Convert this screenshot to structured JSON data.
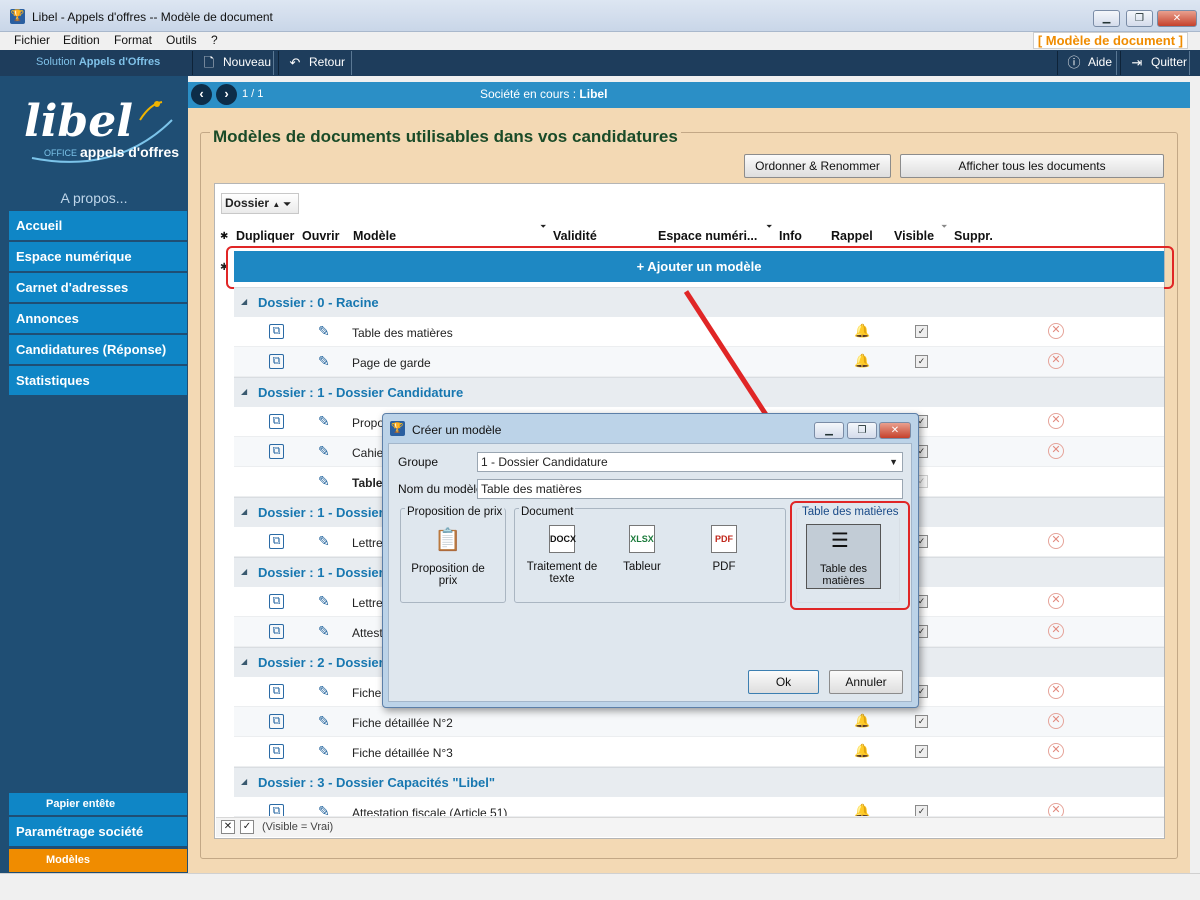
{
  "window": {
    "title": "Libel - Appels d'offres -- Modèle de document",
    "min": "▁",
    "max": "❐",
    "close": "✕"
  },
  "menu": [
    "Fichier",
    "Edition",
    "Format",
    "Outils",
    "?"
  ],
  "model_tag": "[ Modèle de document ]",
  "toolbar": {
    "solution_prefix": "Solution",
    "solution_name": "Appels d'Offres",
    "new_label": "Nouveau",
    "back_label": "Retour",
    "help_label": "Aide",
    "quit_label": "Quitter"
  },
  "sidebar": {
    "logo_text": "libel",
    "logo_sub_office": "OFFICE",
    "logo_sub": "appels d'offres",
    "about": "A propos...",
    "items": [
      "Accueil",
      "Espace numérique",
      "Carnet d'adresses",
      "Annonces",
      "Candidatures  (Réponse)",
      "Statistiques"
    ],
    "letterhead": "Papier entête",
    "company_settings": "Paramétrage société",
    "models": "Modèles"
  },
  "topbar": {
    "pager": "1 / 1",
    "society_label": "Société en cours :",
    "society": "Libel"
  },
  "main": {
    "title": "Modèles de documents utilisables dans vos candidatures",
    "order_button": "Ordonner & Renommer",
    "show_all_button": "Afficher tous les documents",
    "groupby": "Dossier",
    "columns": [
      "Dupliquer",
      "Ouvrir",
      "Modèle",
      "Validité",
      "Espace numéri...",
      "Info",
      "Rappel",
      "Visible",
      "Suppr."
    ],
    "add_label": "+ Ajouter un modèle",
    "groups": [
      {
        "label": "Dossier : 0 - Racine",
        "rows": [
          {
            "name": "Table des matières",
            "bell": true
          },
          {
            "name": "Page de garde",
            "bell": true
          }
        ]
      },
      {
        "label": "Dossier : 1 - Dossier Candidature",
        "rows": [
          {
            "name": "Propo",
            "bell": false
          },
          {
            "name": "Cahier",
            "bell": false
          },
          {
            "name": "Table",
            "bell": false
          }
        ]
      },
      {
        "label": "Dossier : 1 - Dossier",
        "rows": [
          {
            "name": "Lettre",
            "bell": false
          }
        ]
      },
      {
        "label": "Dossier : 1 - Dossier",
        "rows": [
          {
            "name": "Lettre",
            "bell": false
          },
          {
            "name": "Attest",
            "bell": false
          }
        ]
      },
      {
        "label": "Dossier : 2 - Dossier",
        "rows": [
          {
            "name": "Fiche",
            "bell": false
          },
          {
            "name": "Fiche détaillée N°2",
            "bell": true
          },
          {
            "name": "Fiche détaillée N°3",
            "bell": true
          }
        ]
      },
      {
        "label": "Dossier : 3 - Dossier Capacités \"Libel\"",
        "rows": [
          {
            "name": "Attestation fiscale (Article 51)",
            "bell": true
          }
        ]
      }
    ],
    "filter_text": "(Visible = Vrai)"
  },
  "dialog": {
    "title": "Créer un modèle",
    "group_label": "Groupe",
    "group_value": "1 - Dossier Candidature",
    "name_label": "Nom du modèle",
    "name_value": "Table des matières",
    "box_price": "Proposition de prix",
    "box_doc": "Document",
    "box_toc": "Table des matières",
    "tiles": {
      "price": "Proposition de prix",
      "word": "Traitement de texte",
      "sheet": "Tableur",
      "pdf": "PDF",
      "toc": "Table des matières"
    },
    "ok": "Ok",
    "cancel": "Annuler"
  },
  "colors": {
    "accent": "#0f86c6",
    "sidebar": "#1f4e74",
    "main_bg": "#f3d9b4",
    "highlight": "#e02626",
    "orange": "#f08c00"
  }
}
